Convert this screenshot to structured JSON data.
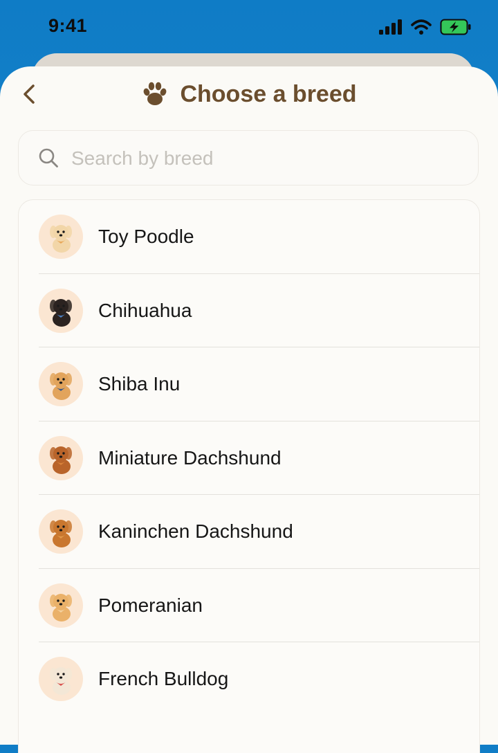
{
  "status_bar": {
    "time": "9:41",
    "icons": [
      "cellular-signal-icon",
      "wifi-icon",
      "battery-charging-icon"
    ],
    "battery_color": "#34c759"
  },
  "header": {
    "title": "Choose a breed",
    "back_icon": "chevron-left-icon",
    "title_icon": "paw-icon",
    "accent_color": "#6b4e2e"
  },
  "search": {
    "placeholder": "Search by breed",
    "value": ""
  },
  "breeds": [
    {
      "label": "Toy Poodle",
      "icon": "toy-poodle-icon",
      "coat": "#f2d6a8",
      "accent": "#e8a85a"
    },
    {
      "label": "Chihuahua",
      "icon": "chihuahua-icon",
      "coat": "#2b2320",
      "accent": "#4a7fc1"
    },
    {
      "label": "Shiba Inu",
      "icon": "shiba-inu-icon",
      "coat": "#e2a45c",
      "accent": "#3d5a8a"
    },
    {
      "label": "Miniature Dachshund",
      "icon": "miniature-dachshund-icon",
      "coat": "#b9642a",
      "accent": "#d9823a"
    },
    {
      "label": "Kaninchen Dachshund",
      "icon": "kaninchen-dachshund-icon",
      "coat": "#c9772f",
      "accent": "#e09a4a"
    },
    {
      "label": "Pomeranian",
      "icon": "pomeranian-icon",
      "coat": "#eab169",
      "accent": "#f4d2a0"
    },
    {
      "label": "French Bulldog",
      "icon": "french-bulldog-icon",
      "coat": "#f3e7d6",
      "accent": "#d9534f"
    }
  ]
}
